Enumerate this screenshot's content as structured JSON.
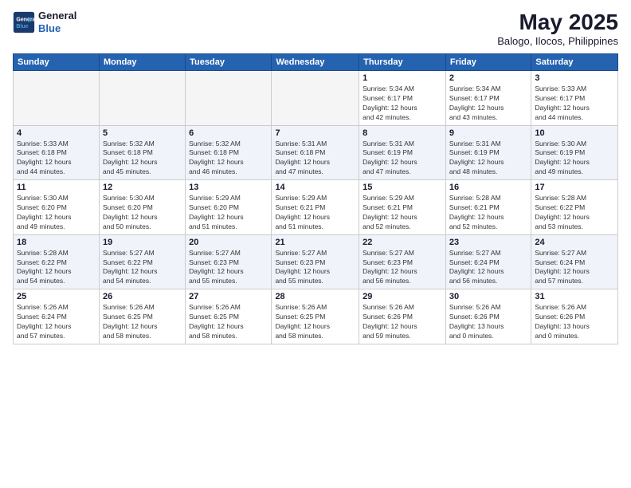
{
  "logo": {
    "line1": "General",
    "line2": "Blue"
  },
  "title": "May 2025",
  "subtitle": "Balogo, Ilocos, Philippines",
  "days_of_week": [
    "Sunday",
    "Monday",
    "Tuesday",
    "Wednesday",
    "Thursday",
    "Friday",
    "Saturday"
  ],
  "weeks": [
    [
      {
        "day": "",
        "info": ""
      },
      {
        "day": "",
        "info": ""
      },
      {
        "day": "",
        "info": ""
      },
      {
        "day": "",
        "info": ""
      },
      {
        "day": "1",
        "info": "Sunrise: 5:34 AM\nSunset: 6:17 PM\nDaylight: 12 hours\nand 42 minutes."
      },
      {
        "day": "2",
        "info": "Sunrise: 5:34 AM\nSunset: 6:17 PM\nDaylight: 12 hours\nand 43 minutes."
      },
      {
        "day": "3",
        "info": "Sunrise: 5:33 AM\nSunset: 6:17 PM\nDaylight: 12 hours\nand 44 minutes."
      }
    ],
    [
      {
        "day": "4",
        "info": "Sunrise: 5:33 AM\nSunset: 6:18 PM\nDaylight: 12 hours\nand 44 minutes."
      },
      {
        "day": "5",
        "info": "Sunrise: 5:32 AM\nSunset: 6:18 PM\nDaylight: 12 hours\nand 45 minutes."
      },
      {
        "day": "6",
        "info": "Sunrise: 5:32 AM\nSunset: 6:18 PM\nDaylight: 12 hours\nand 46 minutes."
      },
      {
        "day": "7",
        "info": "Sunrise: 5:31 AM\nSunset: 6:18 PM\nDaylight: 12 hours\nand 47 minutes."
      },
      {
        "day": "8",
        "info": "Sunrise: 5:31 AM\nSunset: 6:19 PM\nDaylight: 12 hours\nand 47 minutes."
      },
      {
        "day": "9",
        "info": "Sunrise: 5:31 AM\nSunset: 6:19 PM\nDaylight: 12 hours\nand 48 minutes."
      },
      {
        "day": "10",
        "info": "Sunrise: 5:30 AM\nSunset: 6:19 PM\nDaylight: 12 hours\nand 49 minutes."
      }
    ],
    [
      {
        "day": "11",
        "info": "Sunrise: 5:30 AM\nSunset: 6:20 PM\nDaylight: 12 hours\nand 49 minutes."
      },
      {
        "day": "12",
        "info": "Sunrise: 5:30 AM\nSunset: 6:20 PM\nDaylight: 12 hours\nand 50 minutes."
      },
      {
        "day": "13",
        "info": "Sunrise: 5:29 AM\nSunset: 6:20 PM\nDaylight: 12 hours\nand 51 minutes."
      },
      {
        "day": "14",
        "info": "Sunrise: 5:29 AM\nSunset: 6:21 PM\nDaylight: 12 hours\nand 51 minutes."
      },
      {
        "day": "15",
        "info": "Sunrise: 5:29 AM\nSunset: 6:21 PM\nDaylight: 12 hours\nand 52 minutes."
      },
      {
        "day": "16",
        "info": "Sunrise: 5:28 AM\nSunset: 6:21 PM\nDaylight: 12 hours\nand 52 minutes."
      },
      {
        "day": "17",
        "info": "Sunrise: 5:28 AM\nSunset: 6:22 PM\nDaylight: 12 hours\nand 53 minutes."
      }
    ],
    [
      {
        "day": "18",
        "info": "Sunrise: 5:28 AM\nSunset: 6:22 PM\nDaylight: 12 hours\nand 54 minutes."
      },
      {
        "day": "19",
        "info": "Sunrise: 5:27 AM\nSunset: 6:22 PM\nDaylight: 12 hours\nand 54 minutes."
      },
      {
        "day": "20",
        "info": "Sunrise: 5:27 AM\nSunset: 6:23 PM\nDaylight: 12 hours\nand 55 minutes."
      },
      {
        "day": "21",
        "info": "Sunrise: 5:27 AM\nSunset: 6:23 PM\nDaylight: 12 hours\nand 55 minutes."
      },
      {
        "day": "22",
        "info": "Sunrise: 5:27 AM\nSunset: 6:23 PM\nDaylight: 12 hours\nand 56 minutes."
      },
      {
        "day": "23",
        "info": "Sunrise: 5:27 AM\nSunset: 6:24 PM\nDaylight: 12 hours\nand 56 minutes."
      },
      {
        "day": "24",
        "info": "Sunrise: 5:27 AM\nSunset: 6:24 PM\nDaylight: 12 hours\nand 57 minutes."
      }
    ],
    [
      {
        "day": "25",
        "info": "Sunrise: 5:26 AM\nSunset: 6:24 PM\nDaylight: 12 hours\nand 57 minutes."
      },
      {
        "day": "26",
        "info": "Sunrise: 5:26 AM\nSunset: 6:25 PM\nDaylight: 12 hours\nand 58 minutes."
      },
      {
        "day": "27",
        "info": "Sunrise: 5:26 AM\nSunset: 6:25 PM\nDaylight: 12 hours\nand 58 minutes."
      },
      {
        "day": "28",
        "info": "Sunrise: 5:26 AM\nSunset: 6:25 PM\nDaylight: 12 hours\nand 58 minutes."
      },
      {
        "day": "29",
        "info": "Sunrise: 5:26 AM\nSunset: 6:26 PM\nDaylight: 12 hours\nand 59 minutes."
      },
      {
        "day": "30",
        "info": "Sunrise: 5:26 AM\nSunset: 6:26 PM\nDaylight: 13 hours\nand 0 minutes."
      },
      {
        "day": "31",
        "info": "Sunrise: 5:26 AM\nSunset: 6:26 PM\nDaylight: 13 hours\nand 0 minutes."
      }
    ]
  ]
}
